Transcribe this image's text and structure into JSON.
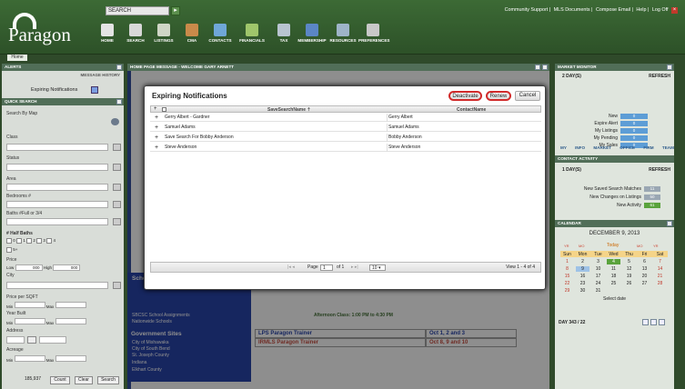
{
  "header": {
    "brand": "Paragon",
    "search_label": "SEARCH",
    "top_links": [
      "Community Support",
      "MLS Documents",
      "Compose Email",
      "Help",
      "Log Off"
    ],
    "nav": [
      {
        "label": "HOME",
        "icon": "house-icon"
      },
      {
        "label": "SEARCH",
        "icon": "document-search-icon"
      },
      {
        "label": "LISTINGS",
        "icon": "listings-icon"
      },
      {
        "label": "CMA",
        "icon": "cma-icon"
      },
      {
        "label": "CONTACTS",
        "icon": "contacts-icon"
      },
      {
        "label": "FINANCIALS",
        "icon": "financials-icon"
      },
      {
        "label": "TAX",
        "icon": "tax-icon"
      },
      {
        "label": "MEMBERSHIP",
        "icon": "membership-icon"
      },
      {
        "label": "RESOURCES",
        "icon": "resources-icon"
      },
      {
        "label": "PREFERENCES",
        "icon": "preferences-icon"
      }
    ],
    "home_tab": "Home"
  },
  "left": {
    "alerts_title": "ALERTS",
    "message_history": "MESSAGE HISTORY",
    "expiring": "Expiring Notifications",
    "quick_search_title": "QUICK SEARCH",
    "search_by_map": "Search By Map",
    "class": "Class",
    "status": "Status",
    "area": "Area",
    "bedrooms": "Bedrooms #",
    "baths": "Baths #Full or 3/4",
    "half_baths": "# Half Baths",
    "half_opts": [
      "0",
      "1",
      "2",
      "3",
      "4",
      "5+"
    ],
    "price": "Price",
    "price_low": "Low",
    "price_low_val": "000",
    "price_high": "High",
    "price_high_val": "000",
    "city": "City",
    "price_sqft": "Price per SQFT",
    "min": "Min",
    "max": "Max",
    "year_built": "Year Built",
    "address": "Address",
    "acreage": "Acreage",
    "count": "185,937",
    "count_btn": "Count",
    "clear_btn": "Clear",
    "search_btn": "Search"
  },
  "middle": {
    "title": "HOME PAGE MESSAGE - WELCOME GARY ARNETT",
    "para_labels": [
      "Parag",
      "Parag",
      "Asso",
      "REAL",
      "Schoo"
    ],
    "blue_title": "Government Sites",
    "blue_items": [
      "City of Mishawaka",
      "City of South Bend",
      "St. Joseph County",
      "Indiana",
      "Elkhart County"
    ],
    "school_items": [
      "SBCSC School Assignments",
      "Nationwide Schools"
    ],
    "afternoon": "Afternoon Class: 1:00 PM to 4:30 PM",
    "classes": [
      {
        "name": "LPS Paragon Trainer",
        "date": "Oct 1, 2 and 3"
      },
      {
        "name": "IRMLS Paragon Trainer",
        "date": "Oct 8, 9 and 10"
      }
    ]
  },
  "modal": {
    "title": "Expiring Notifications",
    "deactivate": "Deactivate",
    "renew": "Renew",
    "cancel": "Cancel",
    "col1": "SaveSearchName",
    "col2": "ContactName",
    "rows": [
      {
        "name": "Gerry Albert - Gardner",
        "contact": "Gerry Albert"
      },
      {
        "name": "Samuel Adams",
        "contact": "Samuel Adams"
      },
      {
        "name": "Save Search For Bobby Anderson",
        "contact": "Bobby Anderson"
      },
      {
        "name": "Steve Anderson",
        "contact": "Steve Anderson"
      }
    ],
    "page_label": "Page",
    "page_val": "1",
    "of_label": "of 1",
    "per_page": "10",
    "view": "View 1 - 4 of 4"
  },
  "right": {
    "market_title": "MARKET MONITOR",
    "period": "2 DAY(S)",
    "refresh": "REFRESH",
    "monitor": [
      {
        "label": "New",
        "val": "0"
      },
      {
        "label": "Expire Alert",
        "val": "0"
      },
      {
        "label": "My Listings",
        "val": "0"
      },
      {
        "label": "My Pending",
        "val": "0"
      },
      {
        "label": "My Sales",
        "val": "0"
      }
    ],
    "tabs": [
      "MY INFO",
      "MARKET",
      "OFFICE",
      "FIRM",
      "TEAM"
    ],
    "contact_title": "CONTACT ACTIVITY",
    "contact_period": "1 DAY(S)",
    "activity": [
      {
        "label": "New Saved Search Matches",
        "val": "11"
      },
      {
        "label": "New Changes on Listings",
        "val": "50"
      },
      {
        "label": "New Activity",
        "val": "61"
      }
    ],
    "cal_title": "CALENDAR",
    "month": "DECEMBER 9, 2013",
    "nav": [
      "YR",
      "MO",
      "Today",
      "MO",
      "YR"
    ],
    "days": [
      "Sun",
      "Mon",
      "Tue",
      "Wed",
      "Thu",
      "Fri",
      "Sat"
    ],
    "weeks": [
      [
        "1",
        "2",
        "3",
        "4",
        "5",
        "6",
        "7"
      ],
      [
        "8",
        "9",
        "10",
        "11",
        "12",
        "13",
        "14"
      ],
      [
        "15",
        "16",
        "17",
        "18",
        "19",
        "20",
        "21"
      ],
      [
        "22",
        "23",
        "24",
        "25",
        "26",
        "27",
        "28"
      ],
      [
        "29",
        "30",
        "31",
        "",
        "",
        "",
        ""
      ]
    ],
    "select_date": "Select date",
    "day_of_year": "DAY 343 / 22"
  }
}
